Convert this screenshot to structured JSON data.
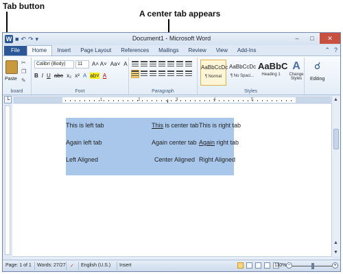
{
  "annotations": {
    "tab_button": "Tab button",
    "center_tab": "A center tab appears"
  },
  "window": {
    "title": "Document1 - Microsoft Word",
    "controls": [
      "–",
      "□",
      "✕"
    ]
  },
  "ribbon_tabs": [
    "File",
    "Home",
    "Insert",
    "Page Layout",
    "References",
    "Mailings",
    "Review",
    "View",
    "Add-Ins"
  ],
  "active_tab": "Home",
  "ribbon": {
    "clipboard": {
      "paste_label": "Paste",
      "group_label": "board"
    },
    "font": {
      "font_name": "Calibri (Body)",
      "font_size": "11",
      "grow_shrink": "A˄ A˅",
      "change_case": "Aa˅",
      "clear_formatting": "A",
      "bold": "B",
      "italic": "I",
      "underline": "U",
      "strike": "abe",
      "subscript": "x₂",
      "superscript": "x²",
      "text_effects": "A",
      "highlight": "ab˅",
      "font_color": "A",
      "group_label": "Font"
    },
    "paragraph": {
      "group_label": "Paragraph"
    },
    "styles": {
      "items": [
        {
          "preview": "AaBbCcDc",
          "name": "¶ Normal"
        },
        {
          "preview": "AaBbCcDc",
          "name": "¶ No Spaci..."
        },
        {
          "preview": "AaBbC",
          "name": "Heading 1"
        }
      ],
      "change_styles": "Change Styles",
      "group_label": "Styles"
    },
    "editing": {
      "label": "Editing"
    }
  },
  "ruler": {
    "tab_button_glyph": "└",
    "center_tab_glyph": "⊥",
    "numbers": [
      "1",
      "2",
      "3",
      "4",
      "5"
    ]
  },
  "document": {
    "rows": [
      {
        "left": "This is left tab",
        "center": "This is center tab",
        "right": "This is right tab"
      },
      {
        "left": "Again left tab",
        "center": "Again center tab",
        "right": "Again right tab"
      },
      {
        "left": "Left Aligned",
        "center": "Center Aligned",
        "right": "Right Aligned"
      }
    ]
  },
  "status": {
    "page": "Page: 1 of 1",
    "words": "Words: 27/27",
    "language": "English (U.S.)",
    "mode": "Insert",
    "zoom": "110%"
  }
}
